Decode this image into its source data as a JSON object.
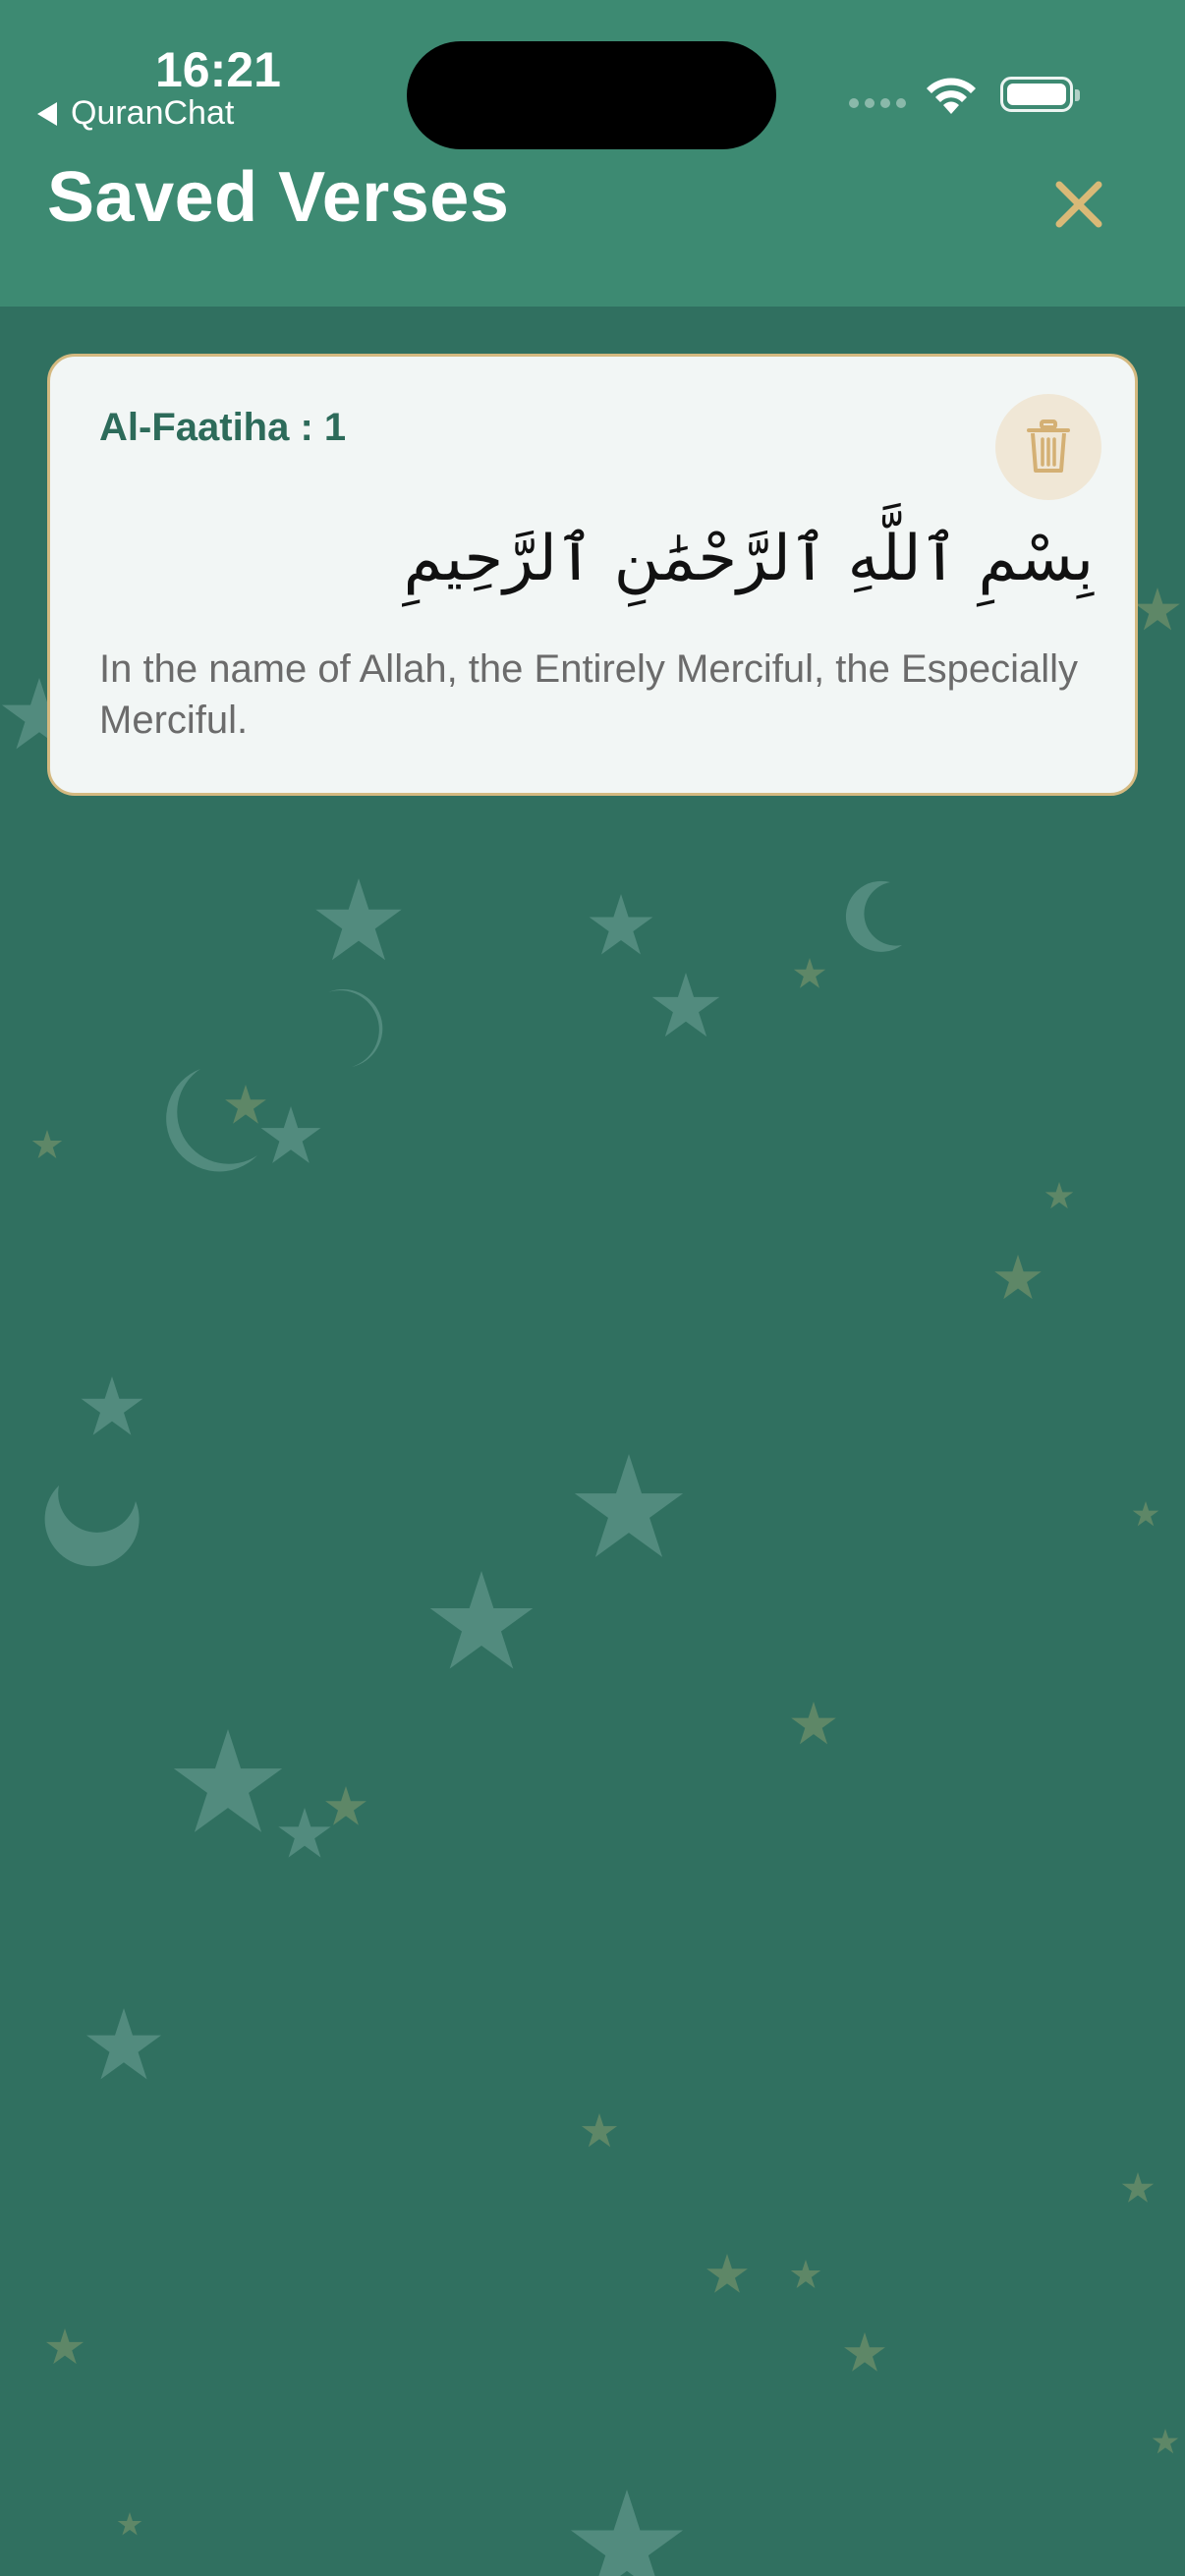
{
  "status_bar": {
    "time": "16:21",
    "back_app": "QuranChat"
  },
  "header": {
    "title": "Saved Verses",
    "close_icon": "close-icon"
  },
  "saved_verses": [
    {
      "reference": "Al-Faatiha : 1",
      "arabic": "بِسْمِ ٱللَّهِ ٱلرَّحْمَٰنِ ٱلرَّحِيمِ",
      "translation": "In the name of Allah, the Entirely Merciful, the Especially Merciful.",
      "delete_icon": "trash-icon"
    }
  ],
  "colors": {
    "background": "#307060",
    "header": "#3d8a72",
    "accent_gold": "#d4b980",
    "card": "#f2f6f5",
    "reference_text": "#2d6b5a"
  }
}
